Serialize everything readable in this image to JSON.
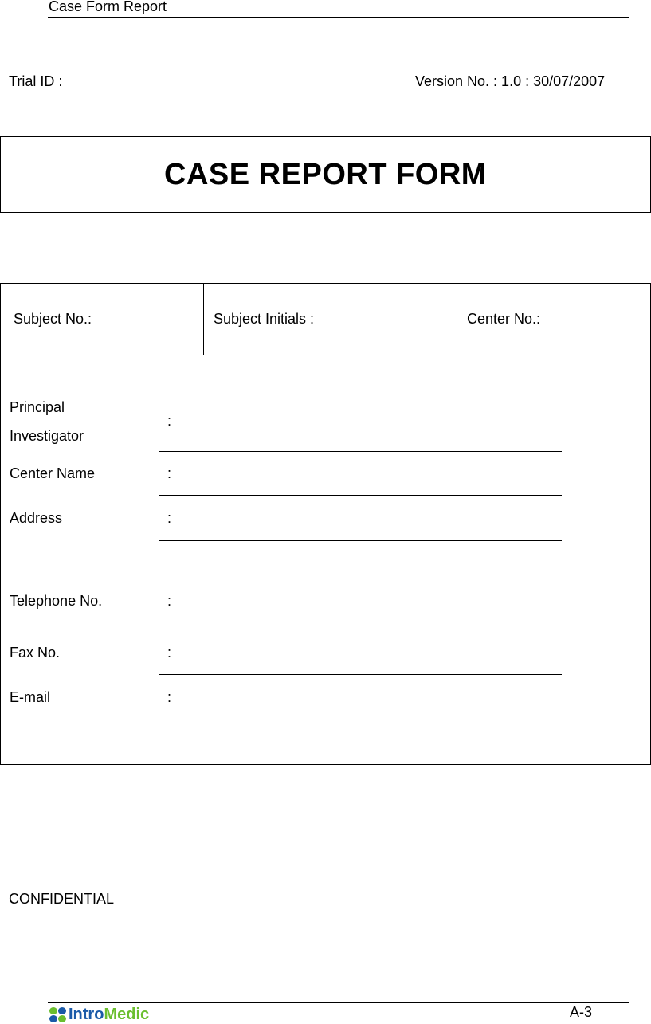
{
  "header": {
    "title": "Case Form Report"
  },
  "meta": {
    "trial_id_label": "Trial ID :",
    "version_label": "Version No. : 1.0 : 30/07/2007"
  },
  "form_title": "CASE REPORT FORM",
  "subject_row": {
    "subject_no_label": "Subject No.:",
    "subject_initials_label": "Subject Initials :",
    "center_no_label": "Center No.:"
  },
  "fields": [
    {
      "label_line1": "Principal",
      "label_line2": "Investigator",
      "colon": ":",
      "value": ""
    },
    {
      "label": "Center Name",
      "colon": ":",
      "value": ""
    },
    {
      "label": "Address",
      "colon": ":",
      "value": "",
      "value_line2": ""
    },
    {
      "label": "Telephone No.",
      "colon": ":",
      "value": ""
    },
    {
      "label": "Fax No.",
      "colon": ":",
      "value": ""
    },
    {
      "label": "E-mail",
      "colon": ":",
      "value": ""
    }
  ],
  "confidential": "CONFIDENTIAL",
  "footer": {
    "logo_intro": "Intro",
    "logo_medic": "Medic",
    "page_number": "A-3",
    "brand_colors": {
      "blue": "#1a5aa8",
      "green": "#6abf2e"
    }
  }
}
